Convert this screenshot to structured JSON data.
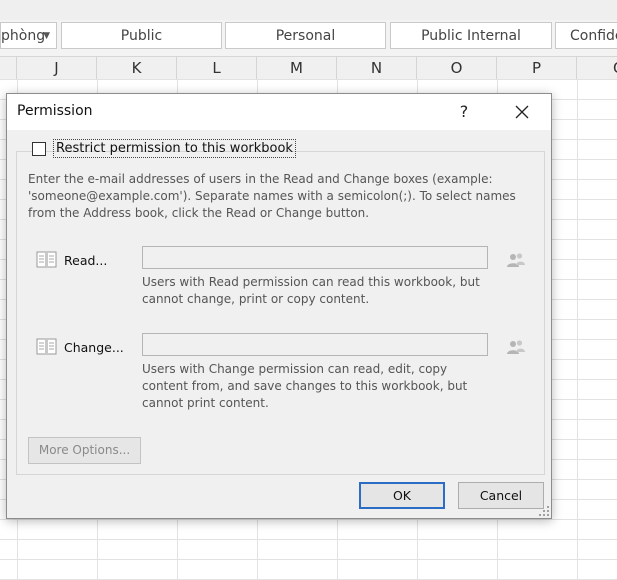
{
  "ribbon": {
    "style_dropdown_label": "phòng",
    "styles": [
      "Public",
      "Personal",
      "Public Internal",
      "Confide"
    ]
  },
  "columns": [
    "J",
    "K",
    "L",
    "M",
    "N",
    "O",
    "P",
    "Q"
  ],
  "dialog": {
    "title": "Permission",
    "help_label": "?",
    "restrict_label": "Restrict permission to this workbook",
    "restrict_checked": false,
    "instructions": "Enter the e-mail addresses of users in the Read and Change boxes (example: 'someone@example.com'). Separate names with a semicolon(;). To select names from the Address book, click the Read or Change button.",
    "read": {
      "button_label": "Read...",
      "value": "",
      "description": "Users with Read permission can read this workbook, but cannot change, print or copy content."
    },
    "change": {
      "button_label": "Change...",
      "value": "",
      "description": "Users with Change permission can read, edit, copy content from, and save changes to this workbook, but cannot print content."
    },
    "more_options_label": "More Options...",
    "ok_label": "OK",
    "cancel_label": "Cancel"
  },
  "colors": {
    "dialog_bg": "#f0f0f0",
    "accent_focus": "#2b6cc4",
    "disabled_text": "#8a8a8a"
  }
}
